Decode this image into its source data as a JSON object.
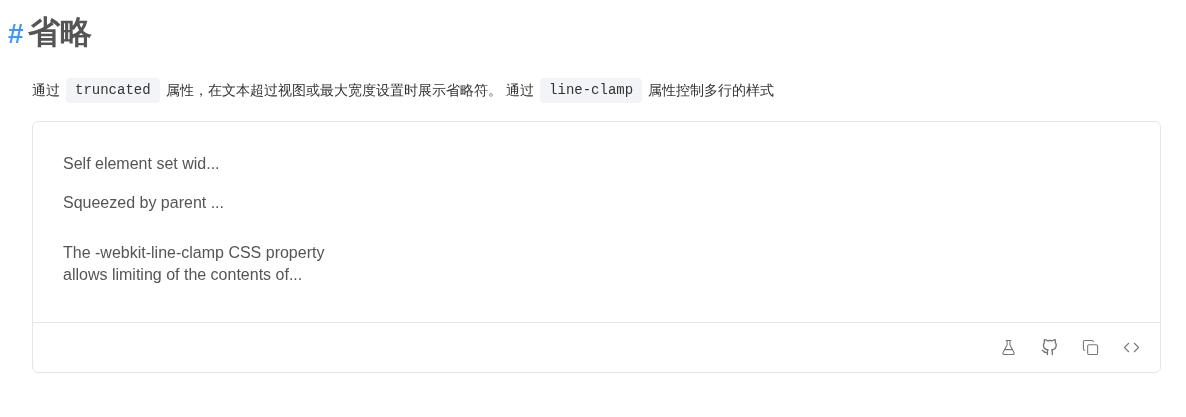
{
  "heading": {
    "anchor": "#",
    "title": "省略"
  },
  "intro": [
    {
      "kind": "text",
      "text": "通过"
    },
    {
      "kind": "code",
      "text": "truncated"
    },
    {
      "kind": "text",
      "text": "属性，在文本超过视图或最大宽度设置时展示省略符。 通过"
    },
    {
      "kind": "code",
      "text": "line-clamp"
    },
    {
      "kind": "text",
      "text": "属性控制多行的样式"
    }
  ],
  "demo": {
    "lines": [
      {
        "kind": "single",
        "text": "Self element set wid..."
      },
      {
        "kind": "single",
        "text": "Squeezed by parent ..."
      },
      {
        "kind": "multi",
        "lines": [
          "The -webkit-line-clamp CSS property",
          "allows limiting of the contents of..."
        ]
      }
    ]
  }
}
